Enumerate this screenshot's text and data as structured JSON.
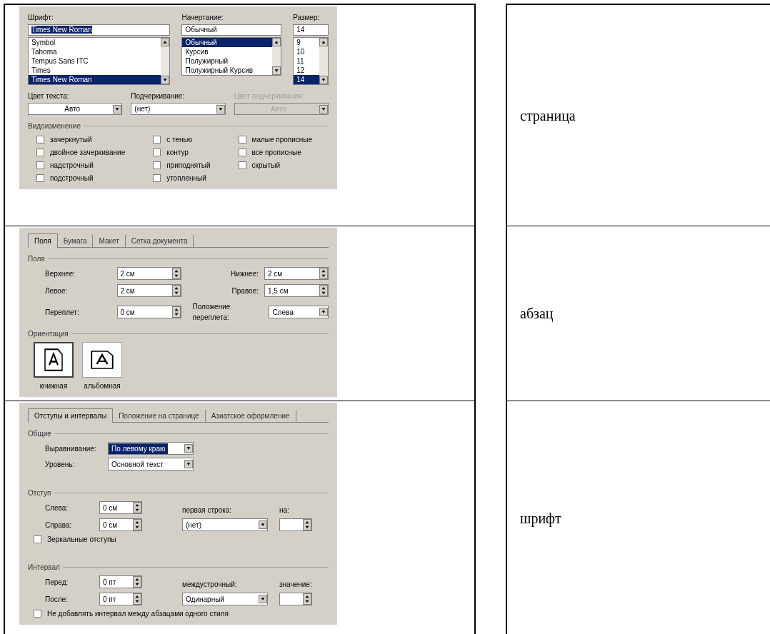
{
  "rows": [
    {
      "dialog": {
        "kind": "font",
        "lists": [
          {
            "label": "Шрифт:",
            "value": "Times New Roman",
            "items": [
              {
                "label": "Symbol",
                "selected": false
              },
              {
                "label": "Tahoma",
                "selected": false
              },
              {
                "label": "Tempus Sans ITC",
                "selected": false
              },
              {
                "label": "Times",
                "selected": false
              },
              {
                "label": "Times New Roman",
                "selected": true
              }
            ]
          },
          {
            "label": "Начертание:",
            "value": "Обычный",
            "items": [
              {
                "label": "Обычный",
                "selected": true
              },
              {
                "label": "Курсив",
                "selected": false
              },
              {
                "label": "Полужирный",
                "selected": false
              },
              {
                "label": "Полужирный Курсив",
                "selected": false
              }
            ]
          },
          {
            "label": "Размер:",
            "value": "14",
            "items": [
              {
                "label": "9",
                "selected": false
              },
              {
                "label": "10",
                "selected": false
              },
              {
                "label": "11",
                "selected": false
              },
              {
                "label": "12",
                "selected": false
              },
              {
                "label": "14",
                "selected": true
              }
            ]
          }
        ],
        "dropdowns": [
          {
            "label": "Цвет текста:",
            "value": "Авто",
            "disabled": false
          },
          {
            "label": "Подчеркивание:",
            "value": "(нет)",
            "disabled": false
          },
          {
            "label": "Цвет подчеркивания:",
            "value": "Авто",
            "disabled": true
          }
        ],
        "effects": {
          "title": "Видоизменение",
          "options": [
            {
              "label": "зачеркнутый",
              "checked": false
            },
            {
              "label": "двойное зачеркивание",
              "checked": false
            },
            {
              "label": "надстрочный",
              "checked": false
            },
            {
              "label": "подстрочный",
              "checked": false
            },
            {
              "label": "с тенью",
              "checked": false
            },
            {
              "label": "контур",
              "checked": false
            },
            {
              "label": "приподнятый",
              "checked": false
            },
            {
              "label": "утопленный",
              "checked": false
            },
            {
              "label": "малые прописные",
              "checked": false
            },
            {
              "label": "все прописные",
              "checked": false
            },
            {
              "label": "скрытый",
              "checked": false
            }
          ]
        }
      },
      "answer": "страница"
    },
    {
      "dialog": {
        "kind": "page",
        "tabs": [
          {
            "label": "Поля",
            "selected": true
          },
          {
            "label": "Бумага",
            "selected": false
          },
          {
            "label": "Макет",
            "selected": false
          },
          {
            "label": "Сетка документа",
            "selected": false
          }
        ],
        "margins": {
          "title": "Поля",
          "fields": [
            {
              "kind": "spin",
              "label": "Верхнее:",
              "value": "2 см"
            },
            {
              "kind": "spin",
              "label": "Нижнее:",
              "value": "2 см"
            },
            {
              "kind": "spin",
              "label": "Левое:",
              "value": "2 см"
            },
            {
              "kind": "spin",
              "label": "Правое:",
              "value": "1,5 см"
            },
            {
              "kind": "spin",
              "label": "Переплет:",
              "value": "0 см"
            },
            {
              "kind": "dropdown",
              "label": "Положение переплета:",
              "value": "Слева"
            }
          ]
        },
        "orientation": {
          "title": "Ориентация",
          "options": [
            {
              "label": "книжная",
              "selected": true
            },
            {
              "label": "альбомная",
              "selected": false
            }
          ]
        }
      },
      "answer": "абзац"
    },
    {
      "dialog": {
        "kind": "paragraph",
        "tabs": [
          {
            "label": "Отступы и интервалы",
            "selected": true
          },
          {
            "label": "Положение на странице",
            "selected": false
          },
          {
            "label": "Азиатское оформление",
            "selected": false
          }
        ],
        "general": {
          "title": "Общие",
          "fields": [
            {
              "label": "Выравнивание:",
              "value": "По левому краю",
              "highlighted": true
            },
            {
              "label": "Уровень:",
              "value": "Основной текст",
              "highlighted": false
            }
          ]
        },
        "indent": {
          "title": "Отступ",
          "spins": [
            {
              "label": "Слева:",
              "value": "0 см"
            },
            {
              "label": "Справа:",
              "value": "0 см"
            }
          ],
          "dropdown": {
            "label": "первая строка:",
            "value": "(нет)"
          },
          "amount": {
            "label": "на:"
          },
          "checkbox": {
            "label": "Зеркальные отступы",
            "checked": false
          }
        },
        "spacing": {
          "title": "Интервал",
          "spins": [
            {
              "label": "Перед:",
              "value": "0 пт"
            },
            {
              "label": "После:",
              "value": "0 пт"
            }
          ],
          "dropdown": {
            "label": "междустрочный:",
            "value": "Одинарный"
          },
          "amount": {
            "label": "значение:"
          },
          "checkbox": {
            "label": "Не добавлять интервал между абзацами одного стиля",
            "checked": false
          }
        }
      },
      "answer": "шрифт"
    }
  ]
}
